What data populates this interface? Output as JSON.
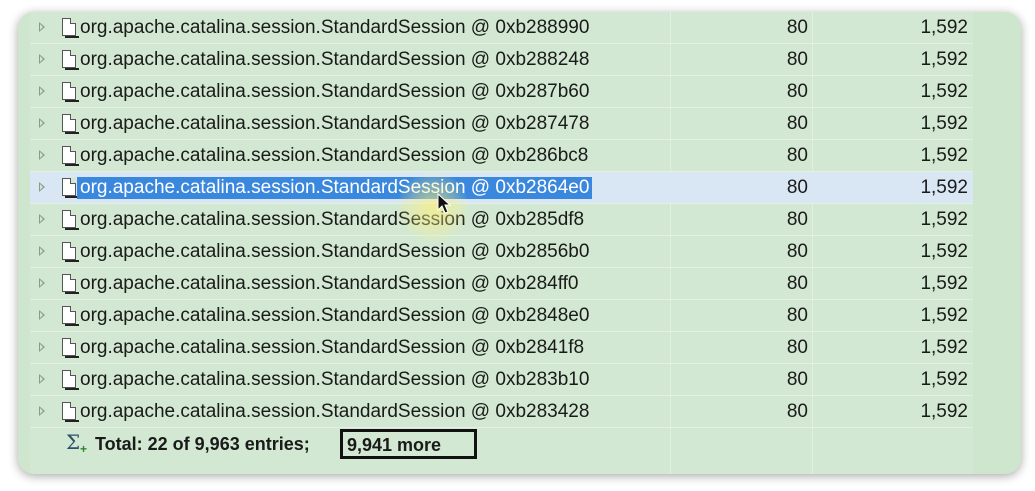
{
  "table": {
    "rows": [
      {
        "name": "org.apache.catalina.session.StandardSession @ 0xb288990",
        "shallow": "80",
        "retained": "1,592"
      },
      {
        "name": "org.apache.catalina.session.StandardSession @ 0xb288248",
        "shallow": "80",
        "retained": "1,592"
      },
      {
        "name": "org.apache.catalina.session.StandardSession @ 0xb287b60",
        "shallow": "80",
        "retained": "1,592"
      },
      {
        "name": "org.apache.catalina.session.StandardSession @ 0xb287478",
        "shallow": "80",
        "retained": "1,592"
      },
      {
        "name": "org.apache.catalina.session.StandardSession @ 0xb286bc8",
        "shallow": "80",
        "retained": "1,592"
      },
      {
        "name": "org.apache.catalina.session.StandardSession @ 0xb2864e0",
        "shallow": "80",
        "retained": "1,592",
        "selected": true
      },
      {
        "name": "org.apache.catalina.session.StandardSession @ 0xb285df8",
        "shallow": "80",
        "retained": "1,592"
      },
      {
        "name": "org.apache.catalina.session.StandardSession @ 0xb2856b0",
        "shallow": "80",
        "retained": "1,592"
      },
      {
        "name": "org.apache.catalina.session.StandardSession @ 0xb284ff0",
        "shallow": "80",
        "retained": "1,592"
      },
      {
        "name": "org.apache.catalina.session.StandardSession @ 0xb2848e0",
        "shallow": "80",
        "retained": "1,592"
      },
      {
        "name": "org.apache.catalina.session.StandardSession @ 0xb2841f8",
        "shallow": "80",
        "retained": "1,592"
      },
      {
        "name": "org.apache.catalina.session.StandardSession @ 0xb283b10",
        "shallow": "80",
        "retained": "1,592"
      },
      {
        "name": "org.apache.catalina.session.StandardSession @ 0xb283428",
        "shallow": "80",
        "retained": "1,592"
      }
    ],
    "total": {
      "label": "Total: 22 of 9,963 entries;",
      "more": "9,941 more",
      "icon": "sigma-sum-icon"
    }
  },
  "icons": {
    "expander": "expand-triangle-icon",
    "object": "object-document-icon",
    "cursor": "mouse-pointer-icon"
  },
  "colors": {
    "background": "#d2e8d2",
    "selection": "#3a88dd",
    "selection_row": "#d9e7f5"
  }
}
